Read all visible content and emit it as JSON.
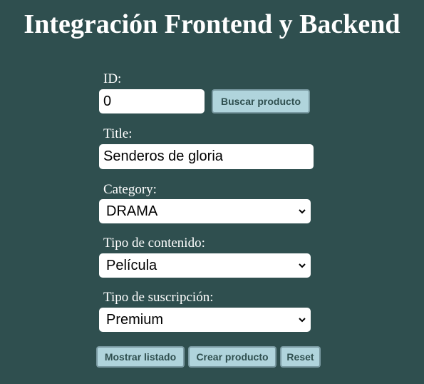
{
  "header": {
    "title": "Integración Frontend y Backend"
  },
  "form": {
    "id_label": "ID:",
    "id_value": "0",
    "search_button": "Buscar producto",
    "title_label": "Title:",
    "title_value": "Senderos de gloria",
    "category_label": "Category:",
    "category_value": "DRAMA",
    "content_type_label": "Tipo de contenido:",
    "content_type_value": "Película",
    "subscription_label": "Tipo de suscripción:",
    "subscription_value": "Premium"
  },
  "actions": {
    "list_button": "Mostrar listado",
    "create_button": "Crear producto",
    "reset_button": "Reset"
  },
  "icons": {
    "select_arrow": "chevron-down-icon"
  },
  "colors": {
    "background": "#2f4f4f",
    "button_bg": "#b0d4dc",
    "button_text": "#2f4f4f",
    "field_bg": "#ffffff"
  }
}
